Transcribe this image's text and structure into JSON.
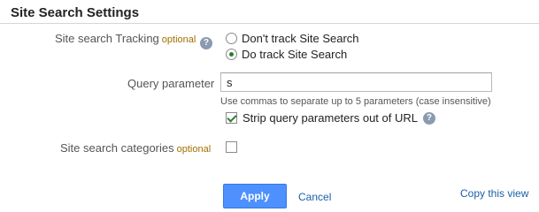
{
  "section": {
    "title": "Site Search Settings"
  },
  "tracking": {
    "label": "Site search Tracking",
    "optional": "optional",
    "help_icon": "?",
    "options": [
      {
        "label": "Don't track Site Search",
        "checked": false
      },
      {
        "label": "Do track Site Search",
        "checked": true
      }
    ]
  },
  "query": {
    "label": "Query parameter",
    "value": "s",
    "hint": "Use commas to separate up to 5 parameters (case insensitive)",
    "strip_label": "Strip query parameters out of URL",
    "strip_checked": true,
    "help_icon": "?"
  },
  "categories": {
    "label": "Site search categories",
    "optional": "optional",
    "checked": false
  },
  "actions": {
    "apply": "Apply",
    "cancel": "Cancel",
    "copy": "Copy this view"
  },
  "colors": {
    "accent_button": "#4d90fe",
    "link": "#1a5fa8",
    "optional_text": "#a07000"
  }
}
